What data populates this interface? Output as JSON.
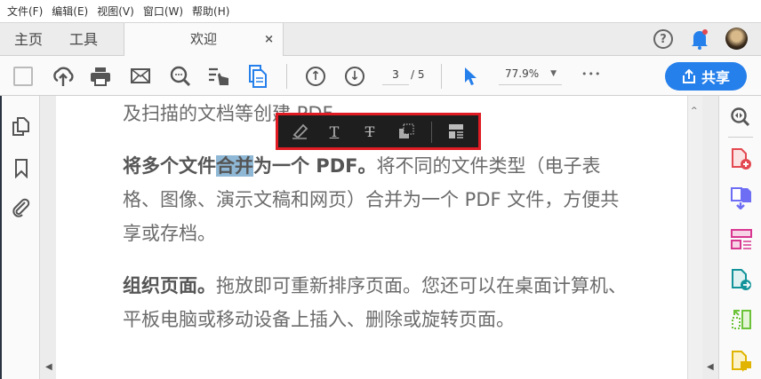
{
  "menu": [
    "文件(F)",
    "编辑(E)",
    "视图(V)",
    "窗口(W)",
    "帮助(H)"
  ],
  "tabs": {
    "home": "主页",
    "tools": "工具",
    "doc": "欢迎",
    "close": "×"
  },
  "toolbar": {
    "page_current": "3",
    "page_total": "/ 5",
    "zoom": "77.9%",
    "share": "共享",
    "more": "•••"
  },
  "document": {
    "line0": "及扫描的文档等创建 PDF。",
    "p1_bold_a": "将多个文件",
    "p1_bold_hl": "合并",
    "p1_bold_b": "为一个 PDF。",
    "p1_text": "将不同的文件类型（电子表格、图像、演示文稿和网页）合并为一个 PDF 文件，方便共享或存档。",
    "p2_bold": "组织页面。",
    "p2_text": "拖放即可重新排序页面。您还可以在桌面计算机、平板电脑或移动设备上插入、删除或旋转页面。"
  },
  "colors": {
    "accent": "#2680eb",
    "popup_border": "#e01b24",
    "highlight": "#8fb8d6"
  }
}
